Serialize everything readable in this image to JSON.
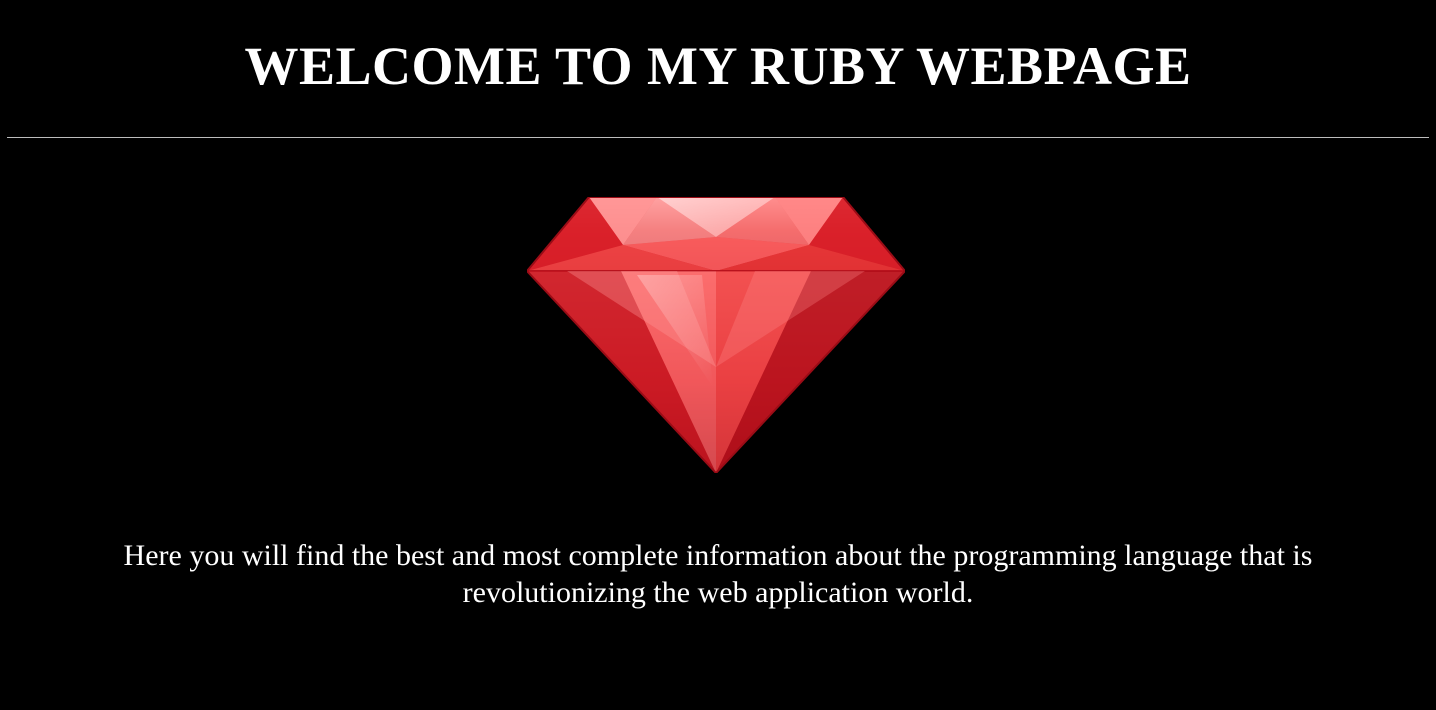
{
  "header": {
    "title": "WELCOME TO MY RUBY WEBPAGE"
  },
  "hero": {
    "image": "ruby-gem-icon",
    "alt": "Ruby gem"
  },
  "content": {
    "intro": "Here you will find the best and most complete information about the programming language that is revolutionizing the web application world."
  },
  "colors": {
    "background": "#000000",
    "text": "#ffffff",
    "divider": "#bdbdbd",
    "ruby": "#e0202a"
  }
}
